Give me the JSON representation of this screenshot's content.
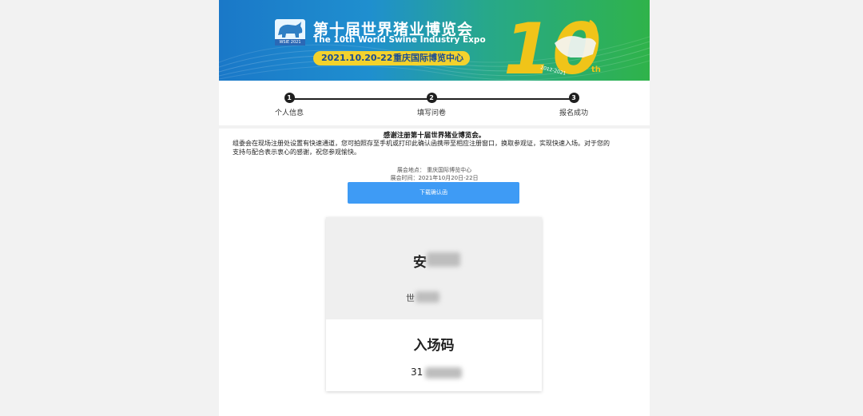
{
  "banner": {
    "title": "第十届世界猪业博览会",
    "subtitle": "The 10th World Swine Industry Expo",
    "date": "2021.10.20-22",
    "venue": "重庆国际博览中心",
    "logo_text": "WSIE 2021",
    "anniversary": "10",
    "anniversary_suffix": "th",
    "anniversary_years": "2012-2021"
  },
  "steps": [
    {
      "number": "1",
      "label": "个人信息"
    },
    {
      "number": "2",
      "label": "填写问卷"
    },
    {
      "number": "3",
      "label": "报名成功"
    }
  ],
  "message": {
    "title": "感谢注册第十届世界猪业博览会。",
    "line1": "组委会在现场注册处设置有快速通道，您可拍照存至手机或打印此确认函携带至相应注册窗口，换取参观证，实现快速入场。对于您的",
    "line2": "支持与配合表示衷心的感谢，祝您参观愉快。"
  },
  "info": {
    "location": "展会地点： 重庆国际博览中心",
    "time": "展会时间：2021年10月20日-22日"
  },
  "download_button": "下载确认函",
  "card": {
    "name": "安",
    "company": "世",
    "code_title": "入场码",
    "code_value": "31"
  },
  "colors": {
    "button": "#3e9bf5",
    "banner_start": "#1a78c8",
    "banner_end": "#2fb34a",
    "date_pill": "#f3d22c",
    "ten_gold": "#f0c419"
  }
}
